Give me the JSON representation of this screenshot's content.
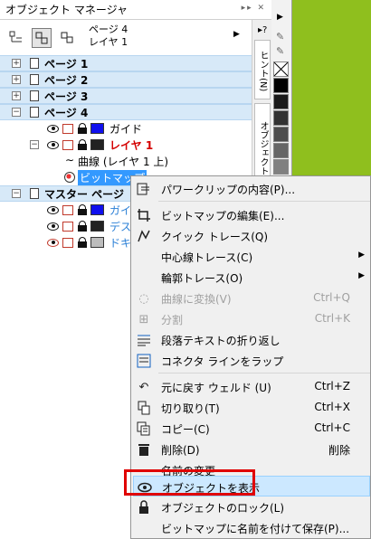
{
  "docker": {
    "title": "オブジェクト マネージャ",
    "page_info": [
      "ページ 4",
      "レイヤ 1"
    ],
    "side_tabs": [
      "ヒント(N)",
      "オブジェクト マ"
    ]
  },
  "tree": {
    "pages": [
      {
        "label": "ページ 1"
      },
      {
        "label": "ページ 2"
      },
      {
        "label": "ページ 3"
      },
      {
        "label": "ページ 4"
      }
    ],
    "page4_children": [
      {
        "label": "ガイド",
        "color": "#1010ee"
      },
      {
        "label": "レイヤ 1",
        "color": "#222222"
      }
    ],
    "layer1_objects": [
      {
        "label": "曲線 (レイヤ 1 上)"
      },
      {
        "label": "ビットマップ"
      }
    ],
    "master": {
      "label": "マスター ページ"
    },
    "master_children": [
      {
        "label": "ガイ",
        "color": "#1010ee"
      },
      {
        "label": "デス",
        "color": "#222222"
      },
      {
        "label": "ドキ",
        "color": "#bdbdbd"
      }
    ]
  },
  "palette_colors": [
    "#000000",
    "#1a1a1a",
    "#333333",
    "#4d4d4d",
    "#666666",
    "#808080",
    "#999999"
  ],
  "context_menu": {
    "items": [
      {
        "label": "パワークリップの内容(P)...",
        "shortcut": "",
        "icon": "powerclip-icon",
        "disabled": false,
        "submenu": false
      },
      {
        "label": "ビットマップの編集(E)...",
        "shortcut": "",
        "icon": "crop-edit-icon",
        "disabled": false,
        "submenu": false
      },
      {
        "label": "クイック トレース(Q)",
        "shortcut": "",
        "icon": "quick-trace-icon",
        "disabled": false,
        "submenu": false
      },
      {
        "label": "中心線トレース(C)",
        "shortcut": "",
        "icon": "",
        "disabled": false,
        "submenu": true
      },
      {
        "label": "輪郭トレース(O)",
        "shortcut": "",
        "icon": "",
        "disabled": false,
        "submenu": true
      },
      {
        "label": "曲線に変換(V)",
        "shortcut": "Ctrl+Q",
        "icon": "convert-curve-icon",
        "disabled": true,
        "submenu": false
      },
      {
        "label": "分割",
        "shortcut": "Ctrl+K",
        "icon": "break-apart-icon",
        "disabled": true,
        "submenu": false
      },
      {
        "label": "段落テキストの折り返し",
        "shortcut": "",
        "icon": "wrap-text-icon",
        "disabled": false,
        "submenu": false
      },
      {
        "label": "コネクタ ラインをラップ",
        "shortcut": "",
        "icon": "wrap-connector-icon",
        "disabled": false,
        "submenu": false
      },
      {
        "label": "元に戻す ウェルド (U)",
        "shortcut": "Ctrl+Z",
        "icon": "undo-icon",
        "disabled": false,
        "submenu": false
      },
      {
        "label": "切り取り(T)",
        "shortcut": "Ctrl+X",
        "icon": "cut-icon",
        "disabled": false,
        "submenu": false
      },
      {
        "label": "コピー(C)",
        "shortcut": "Ctrl+C",
        "icon": "copy-icon",
        "disabled": false,
        "submenu": false
      },
      {
        "label": "削除(D)",
        "shortcut": "削除",
        "icon": "trash-icon",
        "disabled": false,
        "submenu": false
      },
      {
        "label": "名前の変更",
        "shortcut": "",
        "icon": "",
        "disabled": false,
        "submenu": false
      },
      {
        "label": "オブジェクトを表示",
        "shortcut": "",
        "icon": "eye-icon",
        "disabled": false,
        "submenu": false
      },
      {
        "label": "オブジェクトのロック(L)",
        "shortcut": "",
        "icon": "lock-icon",
        "disabled": false,
        "submenu": false
      },
      {
        "label": "ビットマップに名前を付けて保存(P)...",
        "shortcut": "",
        "icon": "",
        "disabled": false,
        "submenu": false
      }
    ]
  }
}
